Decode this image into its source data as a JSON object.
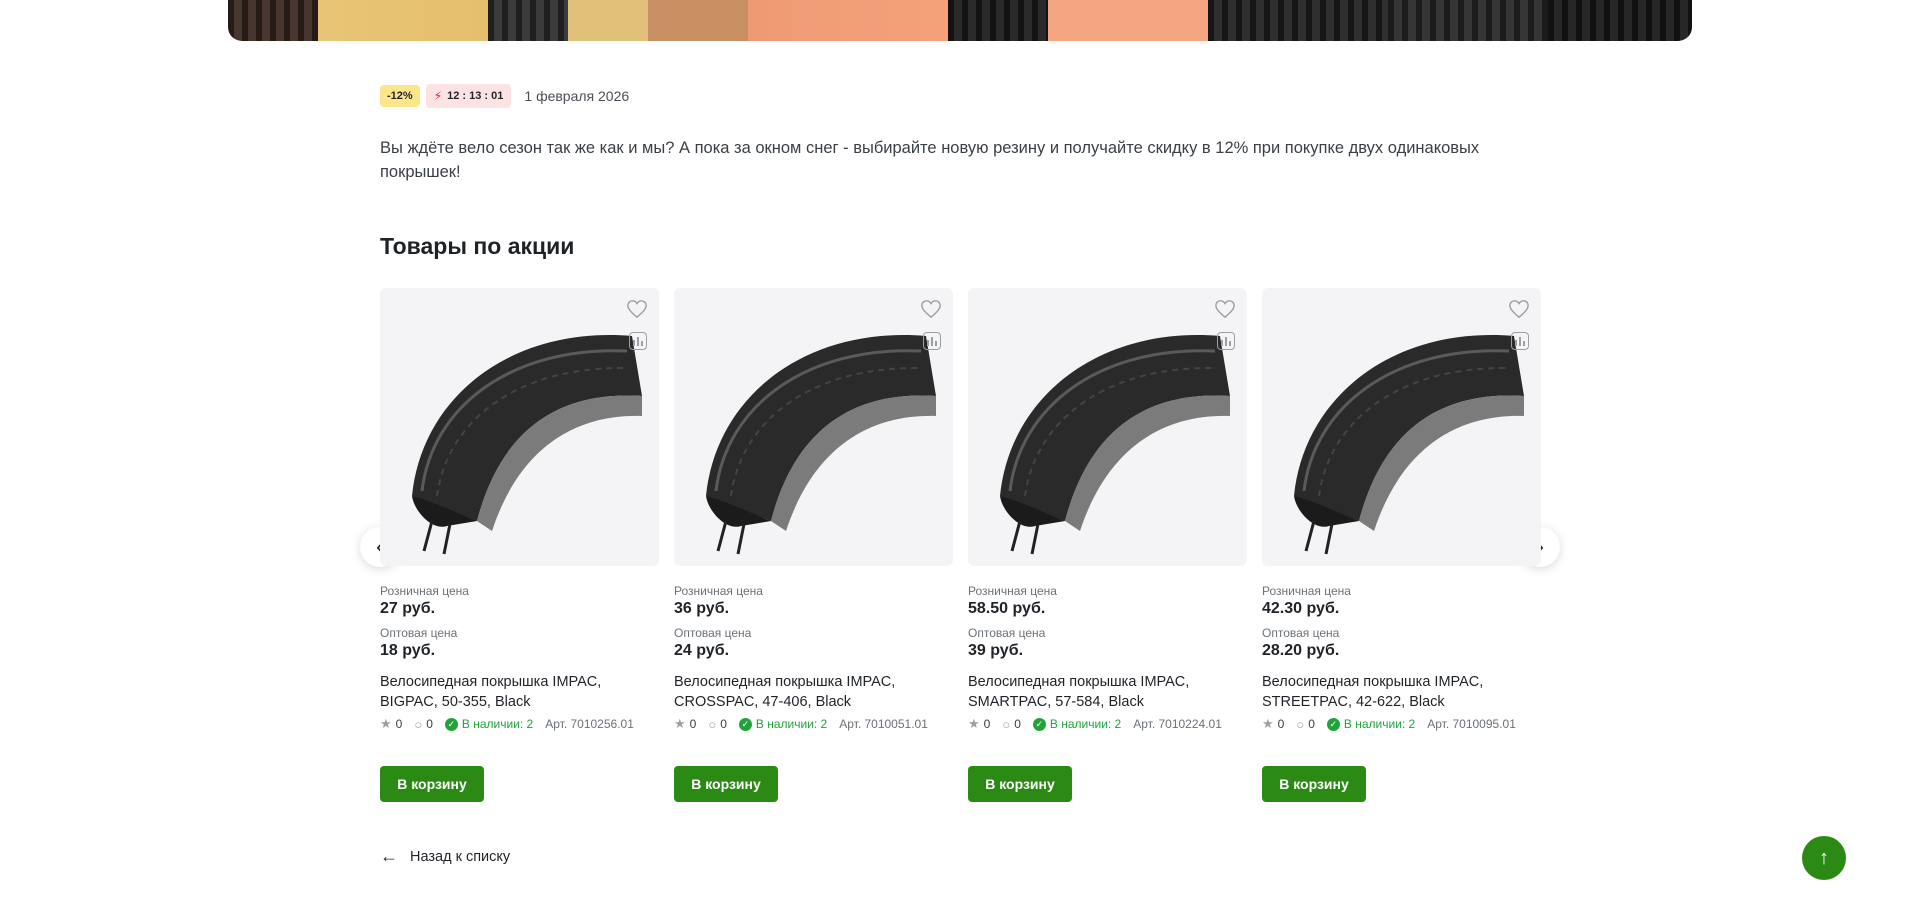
{
  "promo": {
    "discount_badge": "-12%",
    "timer": "12 : 13 : 01",
    "date": "1 февраля 2026",
    "description": "Вы ждёте вело сезон так же как и мы? А пока за окном снег - выбирайте новую резину и получайте скидку в 12% при покупке двух одинаковых покрышек!"
  },
  "section_title": "Товары по акции",
  "icons": {
    "favorite": "heart-icon",
    "compare": "bar-chart-icon",
    "rating": "star-icon",
    "comments": "comment-icon",
    "stock": "check-circle-icon",
    "prev": "chevron-left-icon",
    "next": "chevron-right-icon",
    "back": "arrow-left-icon",
    "to_top": "arrow-up-icon"
  },
  "colors": {
    "accent_green": "#2b8a13",
    "stock_green": "#22a33a",
    "discount_yellow": "#fde68a",
    "timer_pink": "#fde2e4"
  },
  "labels": {
    "retail_price": "Розничная цена",
    "wholesale_price": "Оптовая цена",
    "add_to_cart": "В корзину"
  },
  "products": [
    {
      "retail": "27 руб.",
      "wholesale": "18 руб.",
      "name": "Велосипедная покрышка IMPAC, BIGPAC, 50-355, Black",
      "rating": "0",
      "comments": "0",
      "stock": "В наличии: 2",
      "article": "Арт. 7010256.01"
    },
    {
      "retail": "36 руб.",
      "wholesale": "24 руб.",
      "name": "Велосипедная покрышка IMPAC, CROSSPAC, 47-406, Black",
      "rating": "0",
      "comments": "0",
      "stock": "В наличии: 2",
      "article": "Арт. 7010051.01"
    },
    {
      "retail": "58.50 руб.",
      "wholesale": "39 руб.",
      "name": "Велосипедная покрышка IMPAC, SMARTPAC, 57-584, Black",
      "rating": "0",
      "comments": "0",
      "stock": "В наличии: 2",
      "article": "Арт. 7010224.01"
    },
    {
      "retail": "42.30 руб.",
      "wholesale": "28.20 руб.",
      "name": "Велосипедная покрышка IMPAC, STREETPAC, 42-622, Black",
      "rating": "0",
      "comments": "0",
      "stock": "В наличии: 2",
      "article": "Арт. 7010095.01"
    }
  ],
  "back_link": "Назад к списку"
}
